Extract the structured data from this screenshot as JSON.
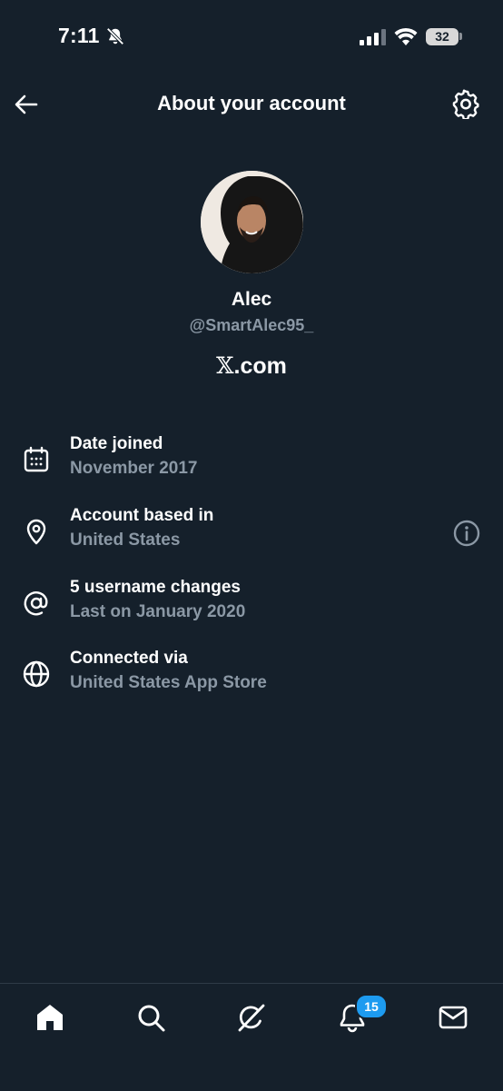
{
  "status_bar": {
    "time": "7:11",
    "battery": "32",
    "icons": [
      "bell-slash-icon",
      "signal-icon",
      "wifi-icon",
      "battery-icon"
    ]
  },
  "header": {
    "title": "About your account",
    "back_icon": "arrow-left-icon",
    "settings_icon": "gear-icon"
  },
  "profile": {
    "name": "Alec",
    "handle": "@SmartAlec95_",
    "site_mark": "𝕏",
    "site_suffix": ".com"
  },
  "details": [
    {
      "icon": "calendar-icon",
      "label": "Date joined",
      "value": "November 2017"
    },
    {
      "icon": "location-pin-icon",
      "label": "Account based in",
      "value": "United States",
      "action_icon": "info-icon"
    },
    {
      "icon": "at-sign-icon",
      "label": "5 username changes",
      "value": "Last on January 2020"
    },
    {
      "icon": "globe-icon",
      "label": "Connected via",
      "value": "United States App Store"
    }
  ],
  "bottom_nav": {
    "items": [
      "home-icon",
      "search-icon",
      "grok-icon",
      "notifications-icon",
      "messages-icon"
    ],
    "notifications_badge": "15"
  },
  "colors": {
    "background": "#15202b",
    "text_primary": "#ffffff",
    "text_secondary": "#8b98a5",
    "accent": "#1d9bf0"
  }
}
